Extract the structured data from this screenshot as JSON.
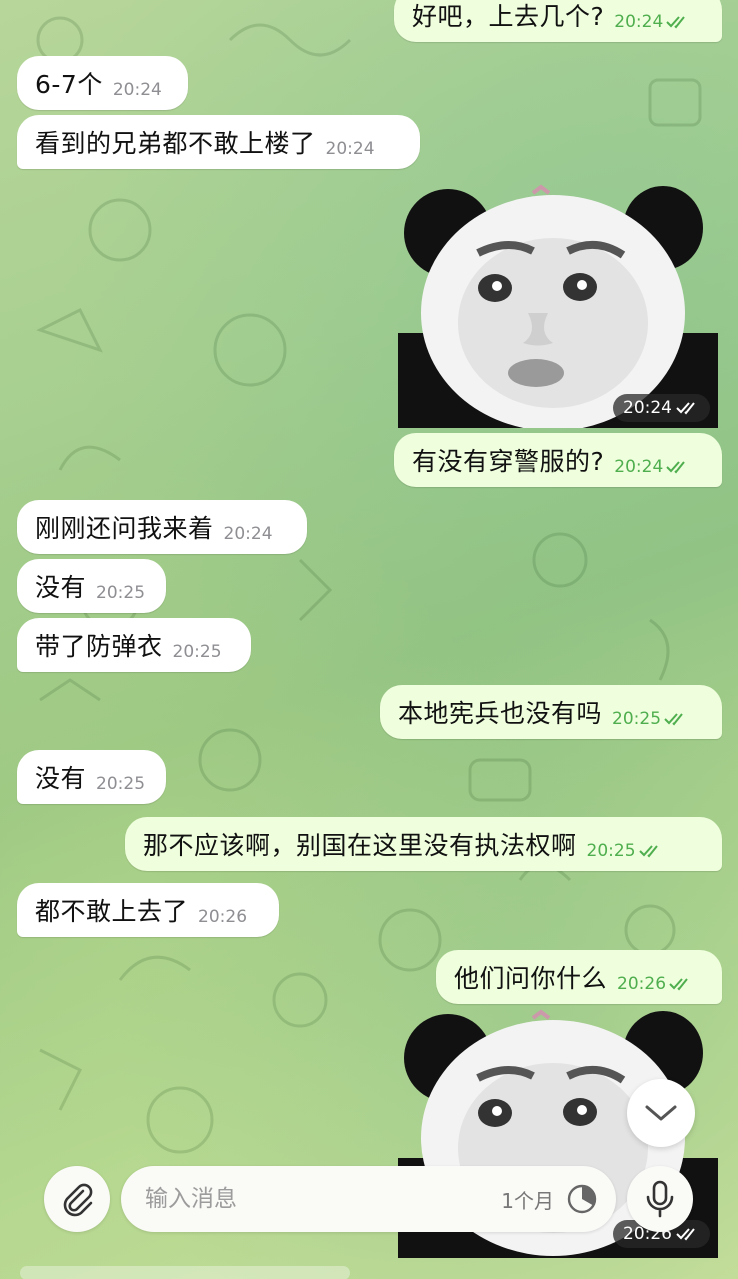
{
  "colors": {
    "incoming_bubble": "#ffffff",
    "outgoing_bubble": "#effedd",
    "outgoing_time": "#4fae4e",
    "incoming_time": "#8e8e93",
    "wallpaper_gradient": [
      "#b7d69a",
      "#95c482",
      "#c7df9a"
    ]
  },
  "messages": [
    {
      "dir": "out",
      "text": "好吧，上去几个?",
      "time": "20:24",
      "read": true
    },
    {
      "dir": "in",
      "text": "6-7个",
      "time": "20:24"
    },
    {
      "dir": "in",
      "text": "看到的兄弟都不敢上楼了",
      "time": "20:24"
    },
    {
      "dir": "out",
      "type": "sticker",
      "sticker": "panda-face-sticker",
      "time": "20:24",
      "read": true
    },
    {
      "dir": "out",
      "text": "有没有穿警服的?",
      "time": "20:24",
      "read": true
    },
    {
      "dir": "in",
      "text": "刚刚还问我来着",
      "time": "20:24"
    },
    {
      "dir": "in",
      "text": "没有",
      "time": "20:25"
    },
    {
      "dir": "in",
      "text": "带了防弹衣",
      "time": "20:25"
    },
    {
      "dir": "out",
      "text": "本地宪兵也没有吗",
      "time": "20:25",
      "read": true
    },
    {
      "dir": "in",
      "text": "没有",
      "time": "20:25"
    },
    {
      "dir": "out",
      "text": "那不应该啊，别国在这里没有执法权啊",
      "time": "20:25",
      "read": true
    },
    {
      "dir": "in",
      "text": "都不敢上去了",
      "time": "20:26"
    },
    {
      "dir": "out",
      "text": "他们问你什么",
      "time": "20:26",
      "read": true
    },
    {
      "dir": "out",
      "type": "sticker",
      "sticker": "panda-face-sticker",
      "time": "20:26",
      "read": true
    }
  ],
  "composer": {
    "placeholder": "输入消息",
    "timer_label": "1个月",
    "attach_icon": "paperclip-icon",
    "timer_icon": "self-destruct-timer-icon",
    "mic_icon": "microphone-icon"
  },
  "scroll_button_icon": "chevron-down-icon"
}
